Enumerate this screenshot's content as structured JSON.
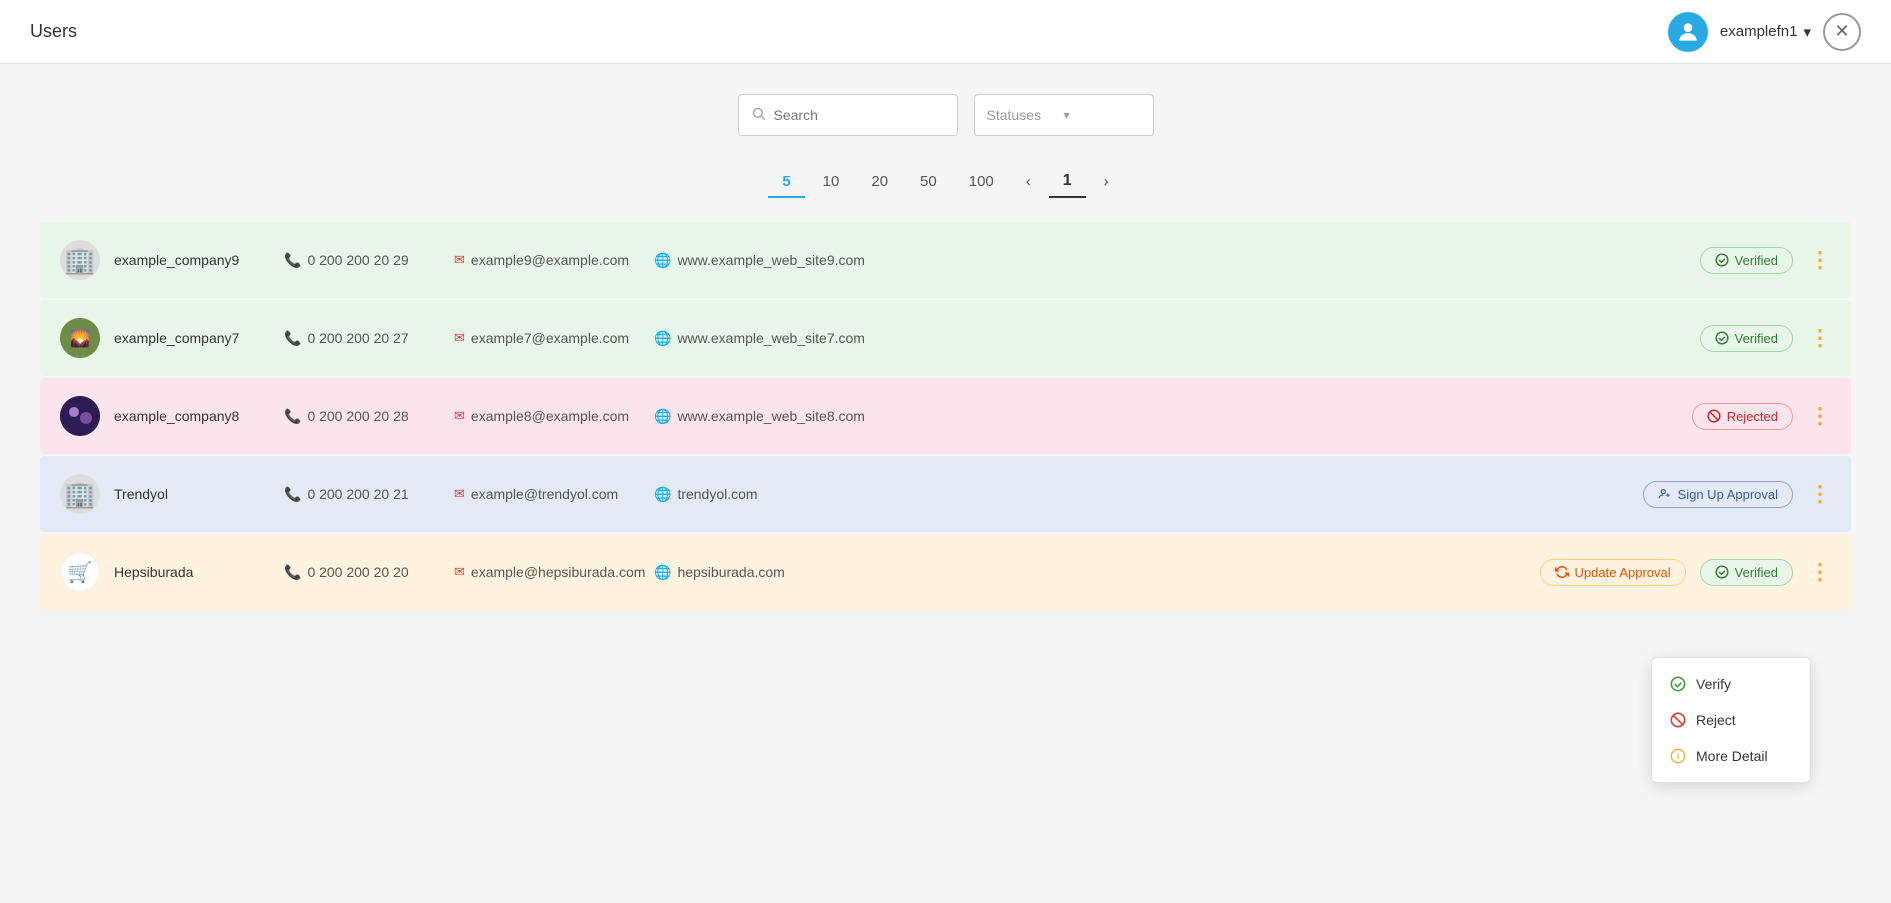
{
  "header": {
    "title": "Users",
    "username": "examplefn1",
    "close_label": "✕"
  },
  "search": {
    "placeholder": "Search",
    "statuses_placeholder": "Statuses"
  },
  "pagination": {
    "sizes": [
      "5",
      "10",
      "20",
      "50",
      "100"
    ],
    "active_size": "5",
    "prev": "‹",
    "next": "›",
    "current_page": "1"
  },
  "rows": [
    {
      "id": "row1",
      "logo_type": "building",
      "name": "example_company9",
      "phone": "0 200 200 20 29",
      "email": "example9@example.com",
      "website": "www.example_web_site9.com",
      "status": "Verified",
      "status_type": "verified",
      "bg": "green"
    },
    {
      "id": "row2",
      "logo_type": "image",
      "logo_bg": "#6d8c4a",
      "name": "example_company7",
      "phone": "0 200 200 20 27",
      "email": "example7@example.com",
      "website": "www.example_web_site7.com",
      "status": "Verified",
      "status_type": "verified",
      "bg": "green"
    },
    {
      "id": "row3",
      "logo_type": "dark_circle",
      "name": "example_company8",
      "phone": "0 200 200 20 28",
      "email": "example8@example.com",
      "website": "www.example_web_site8.com",
      "status": "Rejected",
      "status_type": "rejected",
      "bg": "pink"
    },
    {
      "id": "row4",
      "logo_type": "building",
      "name": "Trendyol",
      "phone": "0 200 200 20 21",
      "email": "example@trendyol.com",
      "website": "trendyol.com",
      "status": "Sign Up Approval",
      "status_type": "signup",
      "bg": "blue"
    },
    {
      "id": "row5",
      "logo_type": "hepsiburada",
      "name": "Hepsiburada",
      "phone": "0 200 200 20 20",
      "email": "example@hepsiburada.com",
      "website": "hepsiburada.com",
      "status_type": "both",
      "status_update": "Update Approval",
      "status_verified": "Verified",
      "bg": "peach"
    }
  ],
  "context_menu": {
    "items": [
      {
        "label": "Verify",
        "type": "verify"
      },
      {
        "label": "Reject",
        "type": "reject"
      },
      {
        "label": "More Detail",
        "type": "detail"
      }
    ]
  }
}
